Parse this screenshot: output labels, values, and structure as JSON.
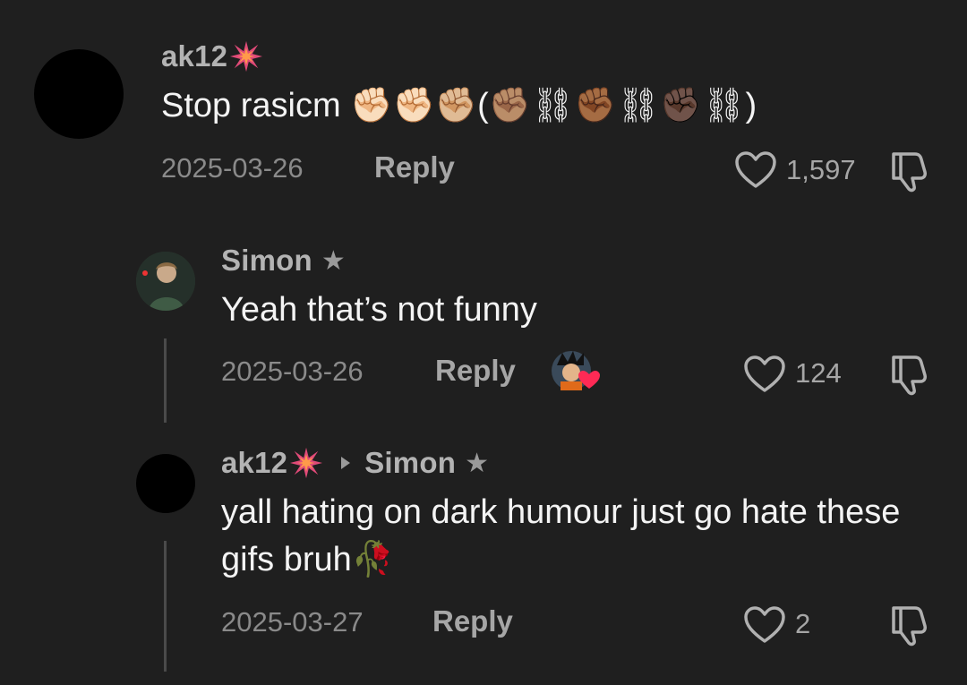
{
  "comments": [
    {
      "username": "ak12",
      "badge_icon": "burst-icon",
      "text": "Stop rasicm ✊🏻✊🏻✊🏼(✊🏽⛓✊🏾⛓✊🏿⛓)",
      "date": "2025-03-26",
      "reply_label": "Reply",
      "likes": "1,597"
    },
    {
      "username": "Simon",
      "star": "★",
      "text": "Yeah that’s not funny",
      "date": "2025-03-26",
      "reply_label": "Reply",
      "likes": "124",
      "creator_liked_icon": "creator-liked-avatar-icon"
    },
    {
      "username": "ak12",
      "badge_icon": "burst-icon",
      "reply_to": "Simon",
      "star": "★",
      "text": "yall hating on dark humour just go hate these gifs bruh🥀",
      "date": "2025-03-27",
      "reply_label": "Reply",
      "likes": "2"
    }
  ],
  "colors": {
    "background": "#1f1f1f",
    "text": "#f4f4f4",
    "muted": "#8a8a8a",
    "badge": "#e0417a"
  }
}
